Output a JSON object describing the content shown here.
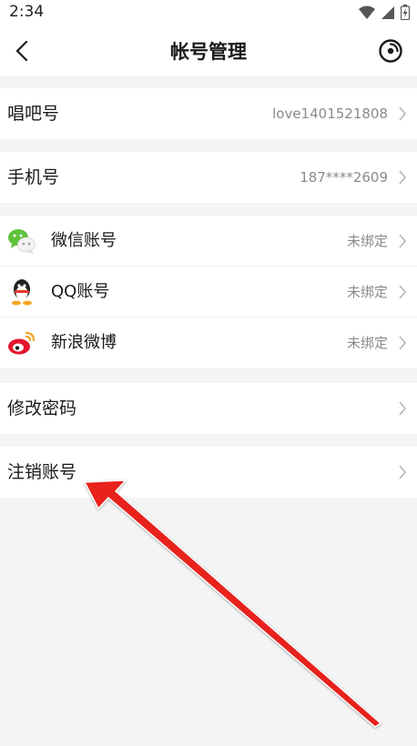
{
  "status_bar": {
    "time": "2:34"
  },
  "header": {
    "title": "帐号管理"
  },
  "rows": {
    "changba_id": {
      "label": "唱吧号",
      "value": "love1401521808"
    },
    "phone": {
      "label": "手机号",
      "value": "187****2609"
    },
    "wechat": {
      "label": "微信账号",
      "value": "未绑定",
      "icon": "wechat-icon"
    },
    "qq": {
      "label": "QQ账号",
      "value": "未绑定",
      "icon": "qq-penguin-icon"
    },
    "weibo": {
      "label": "新浪微博",
      "value": "未绑定",
      "icon": "weibo-icon"
    },
    "change_password": {
      "label": "修改密码"
    },
    "deactivate": {
      "label": "注销账号"
    }
  },
  "colors": {
    "background": "#f4f4f4",
    "surface": "#ffffff",
    "secondary_text": "#8a8a8a",
    "annotation_arrow": "#e8201c"
  }
}
